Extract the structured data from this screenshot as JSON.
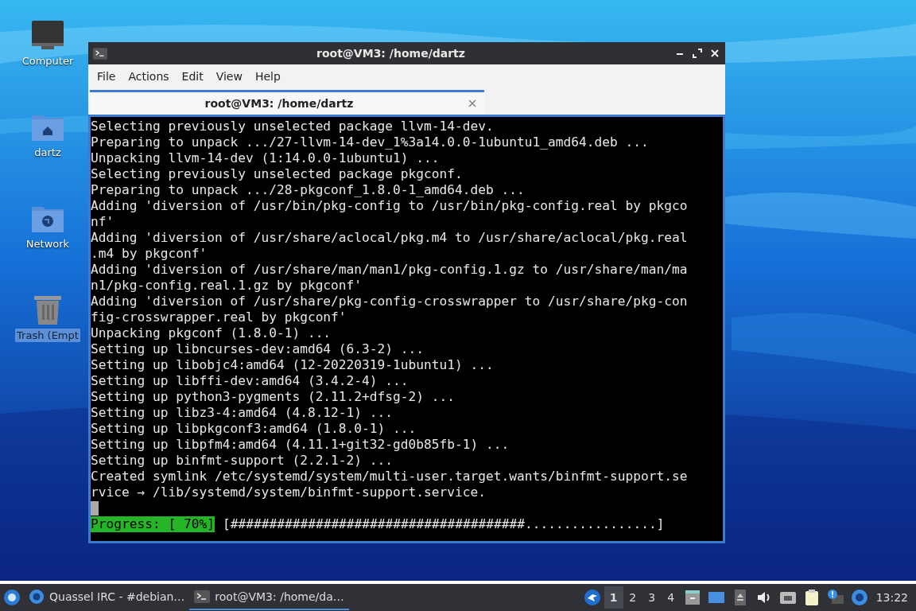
{
  "desktop_icons": [
    {
      "kind": "computer",
      "label": "Computer",
      "selected": false
    },
    {
      "kind": "home",
      "label": "dartz",
      "selected": false
    },
    {
      "kind": "network",
      "label": "Network",
      "selected": false
    },
    {
      "kind": "trash",
      "label": "Trash (Empt",
      "selected": true
    }
  ],
  "window": {
    "title": "root@VM3: /home/dartz",
    "menu": [
      "File",
      "Actions",
      "Edit",
      "View",
      "Help"
    ],
    "tabs": [
      {
        "label": "root@VM3: /home/dartz",
        "selected": true
      }
    ],
    "terminal_lines": [
      "Selecting previously unselected package llvm-14-dev.",
      "Preparing to unpack .../27-llvm-14-dev_1%3a14.0.0-1ubuntu1_amd64.deb ...",
      "Unpacking llvm-14-dev (1:14.0.0-1ubuntu1) ...",
      "Selecting previously unselected package pkgconf.",
      "Preparing to unpack .../28-pkgconf_1.8.0-1_amd64.deb ...",
      "Adding 'diversion of /usr/bin/pkg-config to /usr/bin/pkg-config.real by pkgco",
      "nf'",
      "Adding 'diversion of /usr/share/aclocal/pkg.m4 to /usr/share/aclocal/pkg.real",
      ".m4 by pkgconf'",
      "Adding 'diversion of /usr/share/man/man1/pkg-config.1.gz to /usr/share/man/ma",
      "n1/pkg-config.real.1.gz by pkgconf'",
      "Adding 'diversion of /usr/share/pkg-config-crosswrapper to /usr/share/pkg-con",
      "fig-crosswrapper.real by pkgconf'",
      "Unpacking pkgconf (1.8.0-1) ...",
      "Setting up libncurses-dev:amd64 (6.3-2) ...",
      "Setting up libobjc4:amd64 (12-20220319-1ubuntu1) ...",
      "Setting up libffi-dev:amd64 (3.4.2-4) ...",
      "Setting up python3-pygments (2.11.2+dfsg-2) ...",
      "Setting up libz3-4:amd64 (4.8.12-1) ...",
      "Setting up libpkgconf3:amd64 (1.8.0-1) ...",
      "Setting up libpfm4:amd64 (4.11.1+git32-gd0b85fb-1) ...",
      "Setting up binfmt-support (2.2.1-2) ...",
      "Created symlink /etc/systemd/system/multi-user.target.wants/binfmt-support.se",
      "rvice → /lib/systemd/system/binfmt-support.service."
    ],
    "progress": {
      "label": "Progress: [ 70%]",
      "bar": "[######################################.................]"
    }
  },
  "taskbar": {
    "tasks": [
      {
        "kind": "irc",
        "label": "Quassel IRC - #debian…",
        "selected": false
      },
      {
        "kind": "terminal",
        "label": "root@VM3: /home/da…",
        "selected": true
      }
    ],
    "workspaces": [
      {
        "label": "1",
        "selected": true
      },
      {
        "label": "2",
        "selected": false
      },
      {
        "label": "3",
        "selected": false
      },
      {
        "label": "4",
        "selected": false
      }
    ],
    "clock": "13:22"
  }
}
